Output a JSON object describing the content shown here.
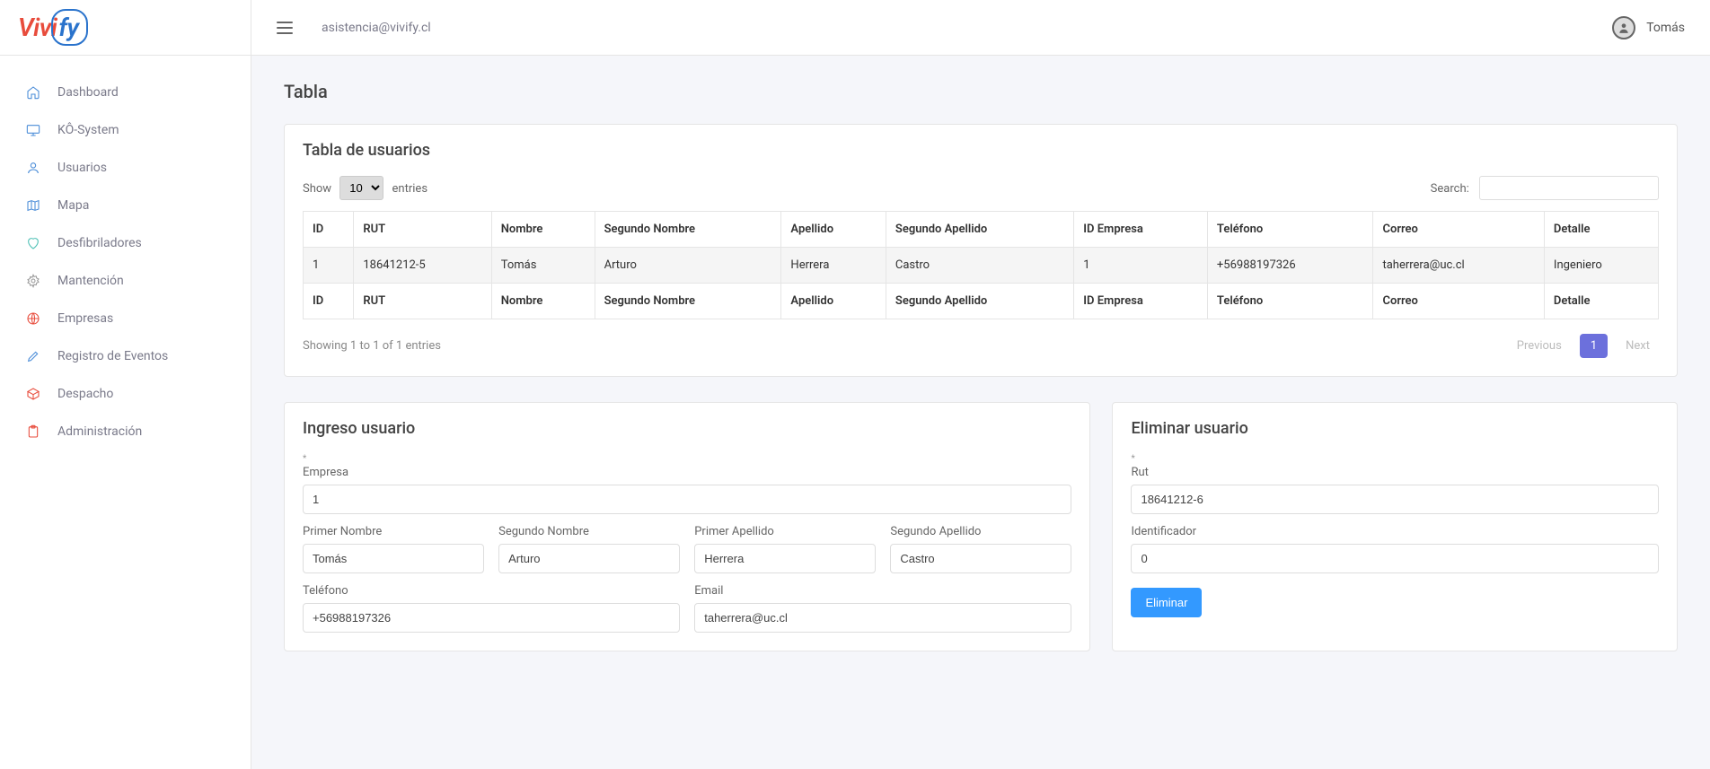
{
  "brand": {
    "part1": "Vivi",
    "part2": "fy"
  },
  "topbar": {
    "email": "asistencia@vivify.cl",
    "username": "Tomás"
  },
  "sidebar": {
    "items": [
      {
        "label": "Dashboard"
      },
      {
        "label": "KÔ-System"
      },
      {
        "label": "Usuarios"
      },
      {
        "label": "Mapa"
      },
      {
        "label": "Desfibriladores"
      },
      {
        "label": "Mantención"
      },
      {
        "label": "Empresas"
      },
      {
        "label": "Registro de Eventos"
      },
      {
        "label": "Despacho"
      },
      {
        "label": "Administración"
      }
    ]
  },
  "page": {
    "title": "Tabla"
  },
  "table_card": {
    "title": "Tabla de usuarios",
    "length_prefix": "Show",
    "length_value": "10",
    "length_suffix": "entries",
    "search_label": "Search:",
    "columns": [
      "ID",
      "RUT",
      "Nombre",
      "Segundo Nombre",
      "Apellido",
      "Segundo Apellido",
      "ID Empresa",
      "Teléfono",
      "Correo",
      "Detalle"
    ],
    "rows": [
      {
        "id": "1",
        "rut": "18641212-5",
        "nombre": "Tomás",
        "segundo_nombre": "Arturo",
        "apellido": "Herrera",
        "segundo_apellido": "Castro",
        "id_empresa": "1",
        "telefono": "+56988197326",
        "correo": "taherrera@uc.cl",
        "detalle": "Ingeniero"
      }
    ],
    "info": "Showing 1 to 1 of 1 entries",
    "prev": "Previous",
    "page": "1",
    "next": "Next"
  },
  "ingreso": {
    "title": "Ingreso usuario",
    "labels": {
      "empresa": "Empresa",
      "primer_nombre": "Primer Nombre",
      "segundo_nombre": "Segundo Nombre",
      "primer_apellido": "Primer Apellido",
      "segundo_apellido": "Segundo Apellido",
      "telefono": "Teléfono",
      "email": "Email"
    },
    "values": {
      "empresa": "1",
      "primer_nombre": "Tomás",
      "segundo_nombre": "Arturo",
      "primer_apellido": "Herrera",
      "segundo_apellido": "Castro",
      "telefono": "+56988197326",
      "email": "taherrera@uc.cl"
    }
  },
  "eliminar": {
    "title": "Eliminar usuario",
    "labels": {
      "rut": "Rut",
      "identificador": "Identificador",
      "button": "Eliminar"
    },
    "values": {
      "rut": "18641212-6",
      "identificador": "0"
    }
  }
}
